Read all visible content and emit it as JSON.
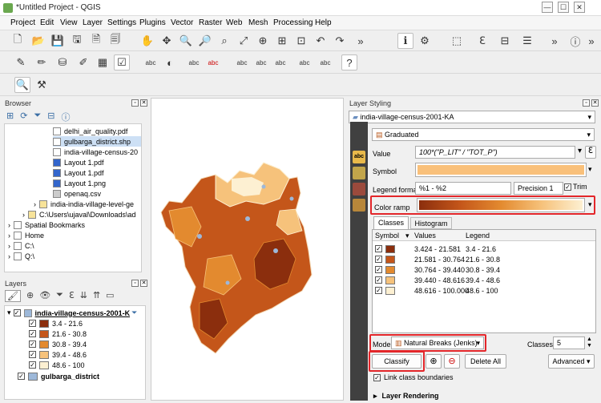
{
  "window": {
    "title": "*Untitled Project - QGIS",
    "min": "—",
    "max": "☐",
    "close": "✕"
  },
  "menu": [
    "Project",
    "Edit",
    "View",
    "Layer",
    "Settings",
    "Plugins",
    "Vector",
    "Raster",
    "Web",
    "Mesh",
    "Processing",
    "Help"
  ],
  "browser": {
    "title": "Browser",
    "items": [
      {
        "label": "delhi_air_quality.pdf",
        "icon": "pdf-icon"
      },
      {
        "label": "gulbarga_district.shp",
        "icon": "vector-layer-icon"
      },
      {
        "label": "india-village-census-20",
        "icon": "vector-layer-icon"
      },
      {
        "label": "Layout 1.pdf",
        "icon": "pdf-icon"
      },
      {
        "label": "Layout 1.pdf",
        "icon": "pdf-icon"
      },
      {
        "label": "Layout 1.png",
        "icon": "image-icon"
      },
      {
        "label": "openaq.csv",
        "icon": "csv-icon"
      },
      {
        "label": "india-india-village-level-ge",
        "icon": "folder-icon"
      },
      {
        "label": "C:\\Users\\ujaval\\Downloads\\ad",
        "icon": "folder-icon"
      },
      {
        "label": "Spatial Bookmarks",
        "icon": "bookmark-icon"
      },
      {
        "label": "Home",
        "icon": "home-icon"
      },
      {
        "label": "C:\\",
        "icon": "drive-icon"
      },
      {
        "label": "Q:\\",
        "icon": "drive-icon"
      }
    ]
  },
  "layers": {
    "title": "Layers",
    "layer1": "india-village-census-2001-K",
    "classes": [
      {
        "label": "3.4 - 21.6",
        "color": "#8b2e0d"
      },
      {
        "label": "21.6 - 30.8",
        "color": "#c4561a"
      },
      {
        "label": "30.8 - 39.4",
        "color": "#e38a2f"
      },
      {
        "label": "39.4 - 48.6",
        "color": "#f6c27b"
      },
      {
        "label": "48.6 - 100",
        "color": "#fdf0d2"
      }
    ],
    "layer2": "gulbarga_district",
    "layer2_color": "#9db8d9"
  },
  "styling": {
    "title": "Layer Styling",
    "layer_select": "india-village-census-2001-KA",
    "renderer": "Graduated",
    "value_label": "Value",
    "value": "100*(\"P_LIT\" / \"TOT_P\")",
    "symbol_label": "Symbol",
    "symbol_color": "#f9c07a",
    "legend_format_label": "Legend format",
    "legend_format": "%1 - %2",
    "precision": "Precision 1",
    "trim": "Trim",
    "color_ramp_label": "Color ramp",
    "tabs": [
      "Classes",
      "Histogram"
    ],
    "col_symbol": "Symbol",
    "col_values": "Values",
    "col_legend": "Legend",
    "rows": [
      {
        "values": "3.424 - 21.581",
        "legend": "3.4 - 21.6",
        "color": "#8b2e0d"
      },
      {
        "values": "21.581 - 30.764",
        "legend": "21.6 - 30.8",
        "color": "#c4561a"
      },
      {
        "values": "30.764 - 39.440",
        "legend": "30.8 - 39.4",
        "color": "#e38a2f"
      },
      {
        "values": "39.440 - 48.616",
        "legend": "39.4 - 48.6",
        "color": "#f6c27b"
      },
      {
        "values": "48.616 - 100.000",
        "legend": "48.6 - 100",
        "color": "#fdf0d2"
      }
    ],
    "mode_label": "Mode",
    "mode": "Natural Breaks (Jenks)",
    "classes_label": "Classes",
    "classes_value": "5",
    "classify": "Classify",
    "delete_all": "Delete All",
    "advanced": "Advanced",
    "link_boundaries": "Link class boundaries",
    "layer_rendering": "Layer Rendering"
  }
}
